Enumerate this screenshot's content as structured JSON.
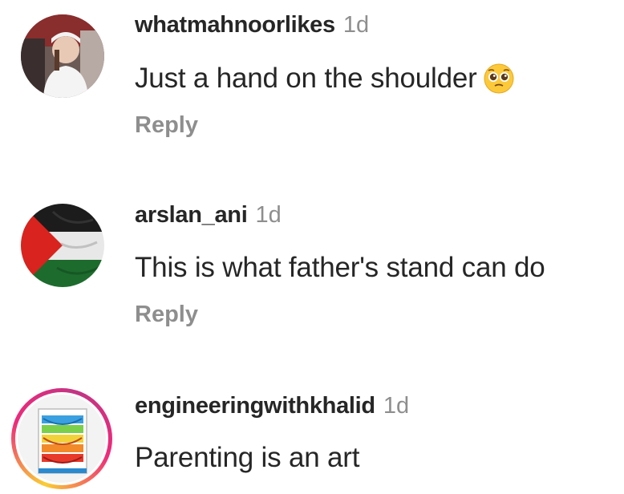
{
  "comments": [
    {
      "username": "whatmahnoorlikes",
      "time": "1d",
      "text": "Just a hand on the shoulder",
      "emoji": "pleading-face-emoji",
      "reply_label": "Reply"
    },
    {
      "username": "arslan_ani",
      "time": "1d",
      "text": "This is what father's stand can do",
      "reply_label": "Reply"
    },
    {
      "username": "engineeringwithkhalid",
      "time": "1d",
      "text": "Parenting is an art"
    }
  ],
  "colors": {
    "username": "#262626",
    "secondary": "#8e8e8e",
    "story_ring_start": "#f9ce34",
    "story_ring_end": "#ee2a7b"
  }
}
